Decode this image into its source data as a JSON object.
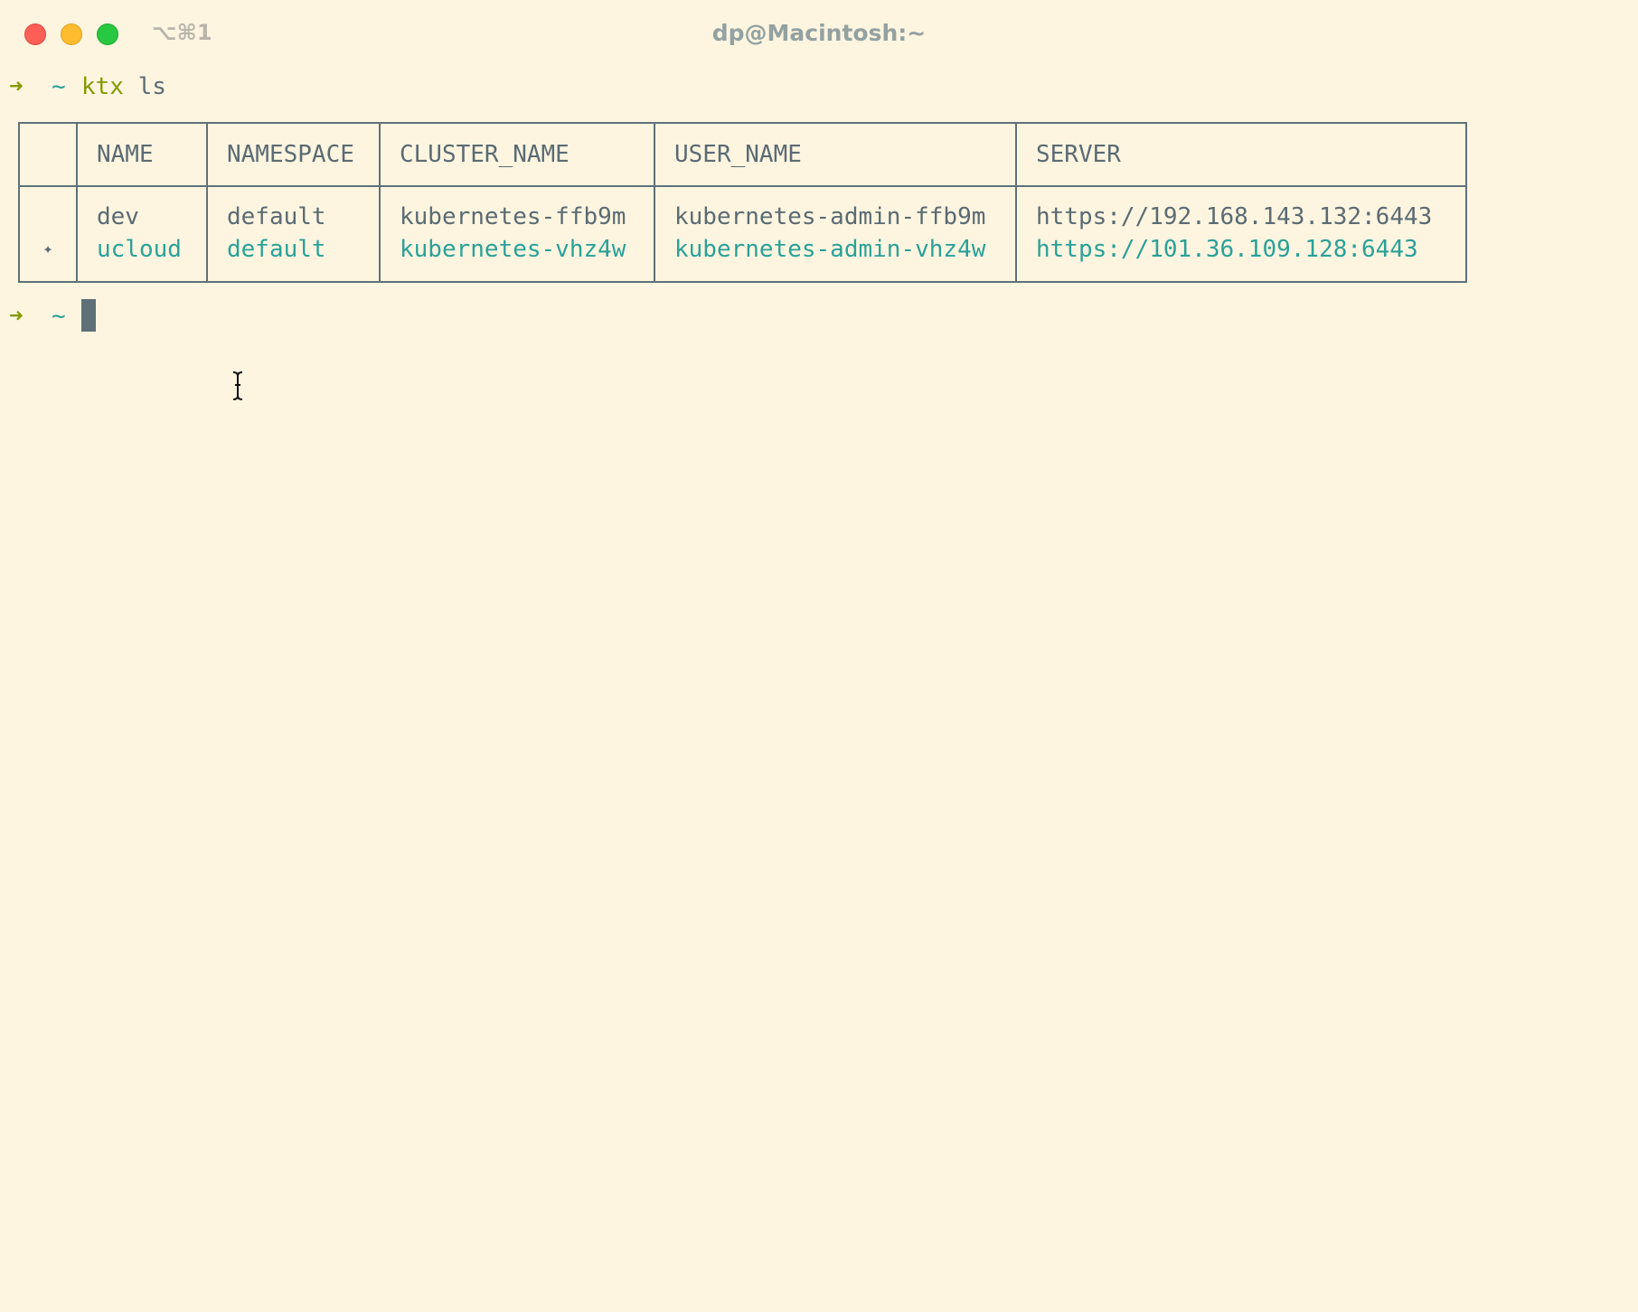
{
  "window": {
    "title": "dp@Macintosh:~",
    "shortcut": "⌥⌘1"
  },
  "prompt": {
    "arrow": "➜",
    "cwd": "~",
    "command": "ktx",
    "args": "ls"
  },
  "table": {
    "headers": [
      "",
      "NAME",
      "NAMESPACE",
      "CLUSTER_NAME",
      "USER_NAME",
      "SERVER"
    ],
    "rows": [
      {
        "marker": "",
        "name": "dev",
        "namespace": "default",
        "cluster_name": "kubernetes-ffb9m",
        "user_name": "kubernetes-admin-ffb9m",
        "server": "https://192.168.143.132:6443",
        "current": false
      },
      {
        "marker": "✦",
        "name": "ucloud",
        "namespace": "default",
        "cluster_name": "kubernetes-vhz4w",
        "user_name": "kubernetes-admin-vhz4w",
        "server": "https://101.36.109.128:6443",
        "current": true
      }
    ]
  },
  "prompt2": {
    "arrow": "➜",
    "cwd": "~"
  },
  "colors": {
    "background": "#fdf5e0",
    "text": "#5b6b73",
    "prompt_arrow": "#859900",
    "cwd": "#2aa198",
    "current_context": "#2aa198"
  }
}
